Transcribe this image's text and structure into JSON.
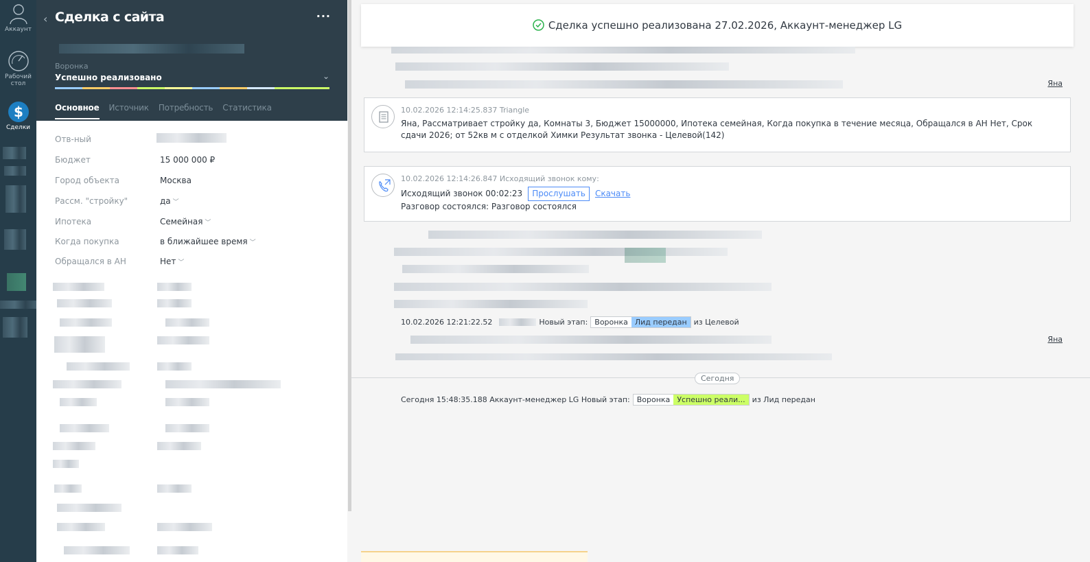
{
  "nav": {
    "account": "Аккаунт",
    "dashboard": "Рабочий стол",
    "deals": "Сделки"
  },
  "card": {
    "title": "Сделка с сайта",
    "pipeline_label": "Воронка",
    "pipeline_value": "Успешно реализовано",
    "tabs": [
      "Основное",
      "Источник",
      "Потребность",
      "Статистика"
    ],
    "fields": [
      {
        "label": "Отв-ный",
        "value": ""
      },
      {
        "label": "Бюджет",
        "value": "15 000 000  ₽"
      },
      {
        "label": "Город объекта",
        "value": "Москва"
      },
      {
        "label": "Рассм. \"стройку\"",
        "value": "да"
      },
      {
        "label": "Ипотека",
        "value": "Семейная"
      },
      {
        "label": "Когда покупка",
        "value": "в ближайшее время"
      },
      {
        "label": "Обращался в АН",
        "value": "Нет"
      }
    ]
  },
  "feed": {
    "banner": "Сделка успешно реализована 27.02.2026, Аккаунт-менеджер LG",
    "author_top": "Яна",
    "note1": {
      "meta": "10.02.2026 12:14:25.837 Triangle",
      "text": "Яна, Рассматривает стройку да, Комнаты 3, Бюджет 15000000, Ипотека семейная, Когда покупка в течение месяца, Обращался в АН Нет, Срок сдачи 2026; от 52кв м с отделкой Химки Результат звонка - Целевой(142)"
    },
    "call": {
      "meta": "10.02.2026 12:14:26.847 Исходящий звонок кому:",
      "title": "Исходящий звонок 00:02:23",
      "listen": "Прослушать",
      "download": "Скачать",
      "result": "Разговор состоялся: Разговор состоялся"
    },
    "event1": {
      "time": "10.02.2026 12:21:22.52",
      "text": "Новый этап:",
      "pipeline": "Воронка",
      "stage": "Лид передан",
      "from": "из Целевой"
    },
    "author_mid": "Яна",
    "today": "Сегодня",
    "event2": {
      "text": "Сегодня 15:48:35.188 Аккаунт-менеджер LG Новый этап:",
      "pipeline": "Воронка",
      "stage": "Успешно реали...",
      "from": "из Лид передан"
    }
  }
}
